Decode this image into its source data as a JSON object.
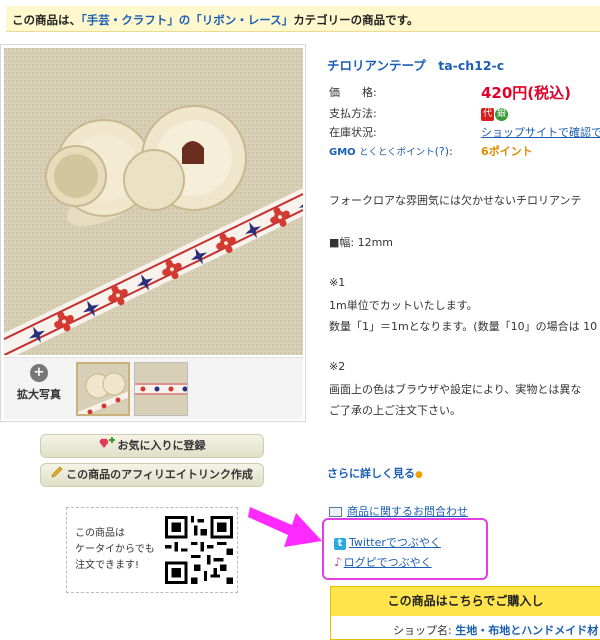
{
  "topbar": {
    "prefix": "この商品は、",
    "category": "「手芸・クラフト」の「リボン・レース」",
    "suffix": "カテゴリーの商品です。"
  },
  "gallery": {
    "zoom_label": "拡大写真",
    "zoom_icon": "plus-icon"
  },
  "buttons": {
    "favorite": "お気に入りに登録",
    "affiliate": "この商品のアフィリエイトリンク作成"
  },
  "mobile": {
    "text": [
      "この商品は",
      "ケータイからでも",
      "注文できます!"
    ]
  },
  "product": {
    "title": "チロリアンテープ　ta-ch12-c",
    "price_label": "価　　格:",
    "price_value": "420円(税込)",
    "payment_label": "支払方法:",
    "payment_badges": [
      "代",
      "銀"
    ],
    "stock_label": "在庫状況:",
    "stock_value": "ショップサイトで確認で",
    "gmo_logo": "GMO",
    "gmo_text": "とくとくポイント",
    "gmo_help": "(?)",
    "gmo_sep": ":",
    "points": "6ポイント"
  },
  "description": {
    "line1": "フォークロアな雰囲気には欠かせないチロリアンテ",
    "line2": "■幅: 12mm",
    "line3": "※1",
    "line4": "1m単位でカットいたします。",
    "line5": "数量「1」＝1mとなります。(数量「10」の場合は 10",
    "line6": "※2",
    "line7": "画面上の色はブラウザや設定により、実物とは異な",
    "line8": "ご了承の上ご注文下さい。"
  },
  "more_link": "さらに詳しく見る",
  "inquiry_link": "商品に関するお問合わせ",
  "social": {
    "twitter": "Twitterでつぶやく",
    "logpi": "ログピでつぶやく"
  },
  "shopbox": {
    "header": "この商品はこちらでご購入し",
    "shop_label": "ショップ名:",
    "shop_name": "生地・布地とハンドメイド材"
  },
  "colors": {
    "accent": "#1a5fb4",
    "price": "#e0002a",
    "highlight_frame": "#e040e0",
    "arrow": "#ff2aff",
    "shopbox_header": "#ffe44d"
  }
}
